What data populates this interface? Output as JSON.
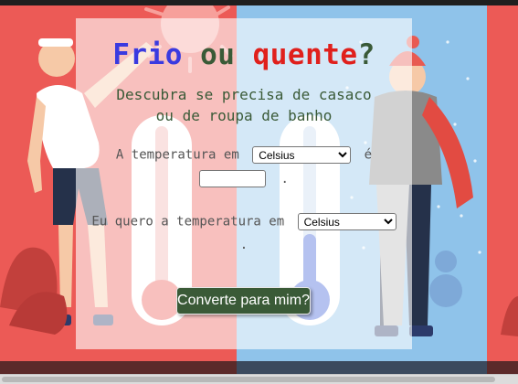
{
  "colors": {
    "hot_background": "#ec5a56",
    "cold_background": "#8fc3ea",
    "title_blue": "#3a3ae0",
    "title_green": "#3a5a37",
    "title_red": "#e0201c",
    "button_background": "#3a5a37"
  },
  "header": {
    "title_word_1": "Frio",
    "title_word_2": "ou",
    "title_word_3": "quente",
    "title_word_4": "?",
    "subtitle_line_1": "Descubra se precisa de casaco",
    "subtitle_line_2": "ou de roupa de banho"
  },
  "form": {
    "input_label": "A temperatura em",
    "input_unit": "Celsius",
    "input_unit_options": [
      "Celsius"
    ],
    "input_suffix": "é",
    "temperature_value": "",
    "temperature_end": ".",
    "output_label": "Eu quero a temperatura em",
    "output_unit": "Celsius",
    "output_unit_options": [
      "Celsius"
    ],
    "result_text": ".",
    "convert_button_label": "Converte para mim?"
  },
  "illustration": {
    "left_scene": "hot-person-icon",
    "left_thermometer": "hot-thermometer-icon",
    "right_scene": "cold-person-icon",
    "right_thermometer": "cold-thermometer-icon",
    "sun": "sun-icon",
    "snowman": "snowman-icon"
  }
}
